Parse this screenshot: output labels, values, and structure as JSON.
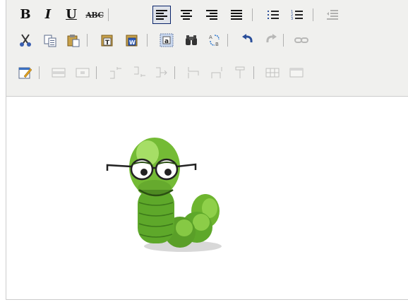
{
  "toolbar": {
    "bold_label": "B",
    "italic_label": "I",
    "underline_label": "U",
    "strikethrough_label": "ABC",
    "row1": [
      "bold",
      "italic",
      "underline",
      "strikethrough",
      "align-left",
      "align-center",
      "align-right",
      "align-justify",
      "bullet-list",
      "numbered-list",
      "outdent"
    ],
    "row2": [
      "cut",
      "copy",
      "paste",
      "paste-text",
      "paste-word",
      "select-all",
      "find",
      "replace",
      "undo",
      "redo",
      "link"
    ],
    "row3": [
      "edit-css",
      "table-row-props",
      "table-cell-props",
      "insert-row-before",
      "insert-row-after",
      "delete-row",
      "insert-col-before",
      "insert-col-after",
      "delete-col",
      "split-cells",
      "merge-cells"
    ]
  },
  "icons": {
    "paste_text_glyph": "T",
    "paste_word_glyph": "W",
    "select_all_glyph": "a",
    "replace_glyph_a": "A",
    "replace_glyph_b": "B"
  },
  "content": {
    "image": "bookworm-with-glasses",
    "worm_color": "#7cc43a"
  }
}
